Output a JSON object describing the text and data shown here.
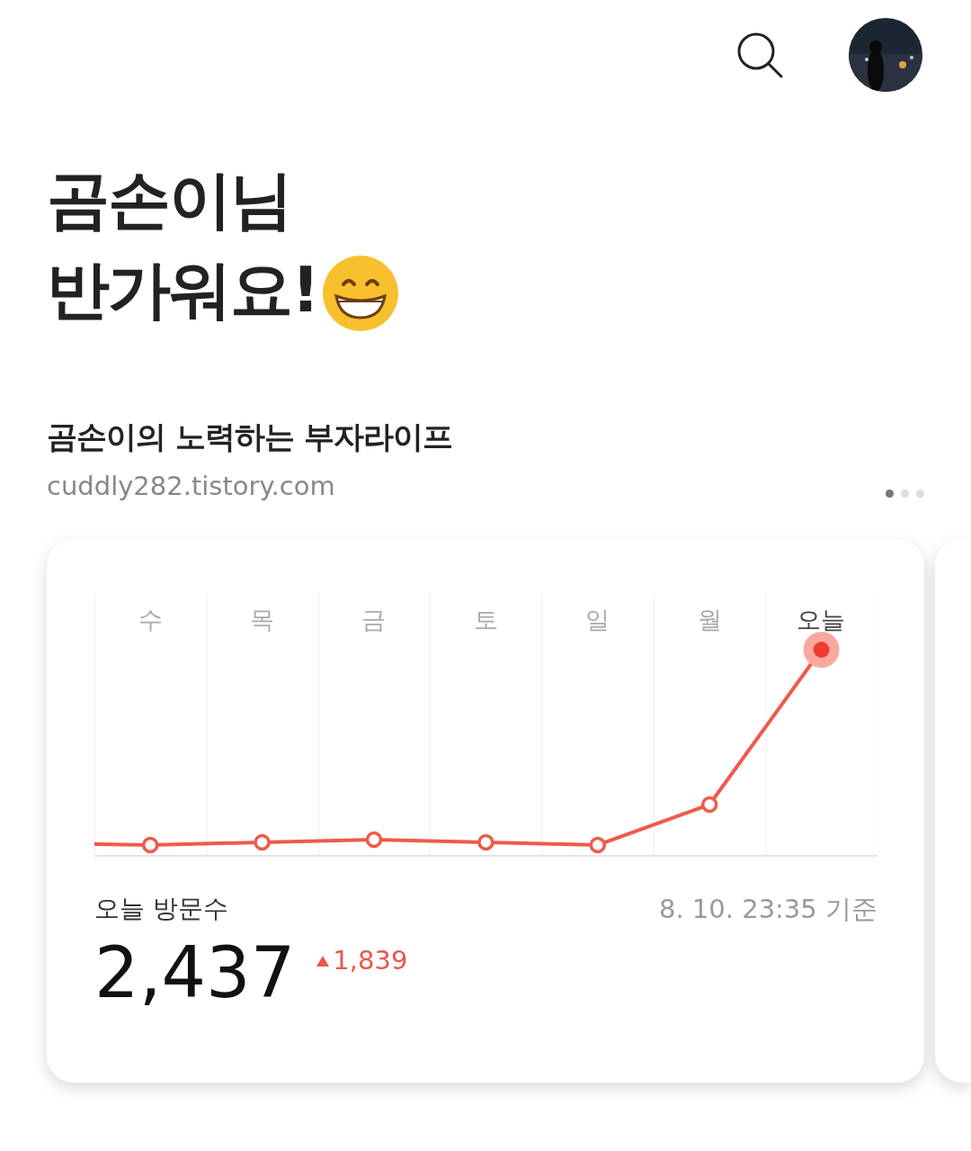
{
  "greeting": {
    "name_line": "곰손이님",
    "welcome_line": "반가워요!"
  },
  "blog": {
    "title": "곰손이의 노력하는 부자라이프",
    "url": "cuddly282.tistory.com"
  },
  "pager": [
    {
      "selected": true
    },
    {
      "selected": false
    },
    {
      "selected": false
    }
  ],
  "card": {
    "days": [
      {
        "label": "수",
        "selected": false
      },
      {
        "label": "목",
        "selected": false
      },
      {
        "label": "금",
        "selected": false
      },
      {
        "label": "토",
        "selected": false
      },
      {
        "label": "일",
        "selected": false
      },
      {
        "label": "월",
        "selected": false
      },
      {
        "label": "오늘",
        "selected": true
      }
    ],
    "visits_label": "오늘 방문수",
    "timestamp": "8. 10. 23:35 기준",
    "visits": "2,437",
    "change": "1,839"
  }
}
